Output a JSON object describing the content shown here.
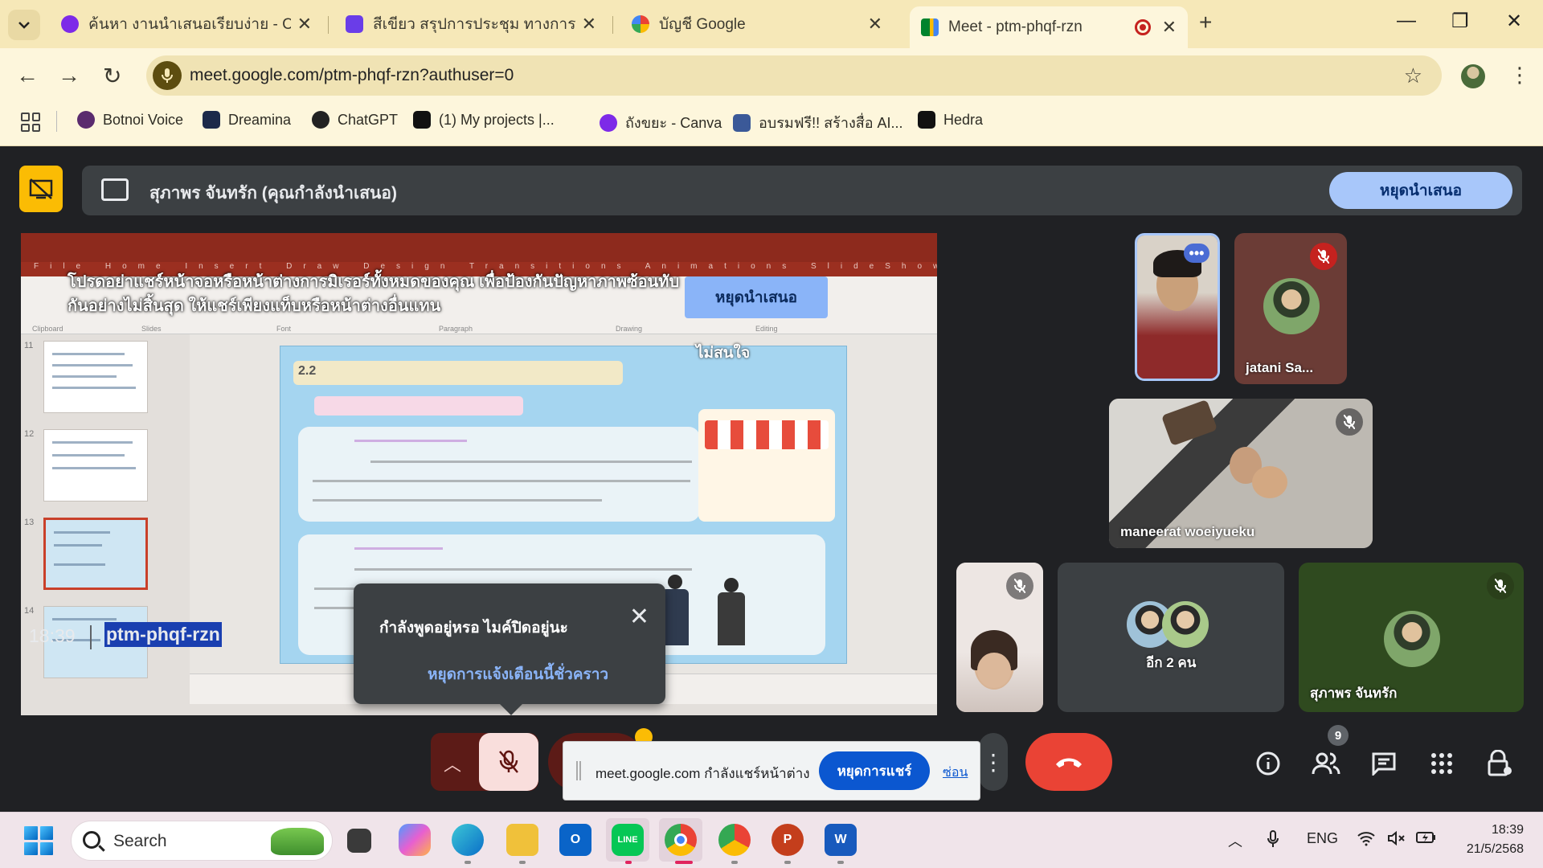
{
  "browser": {
    "tabs": [
      {
        "title": "ค้นหา งานนำเสนอเรียบง่าย - Canva",
        "icon": "canva-icon",
        "color": "#7d2ae8"
      },
      {
        "title": "สีเขียว สรุปการประชุม ทางการ พรีเซ",
        "icon": "canva-icon",
        "color": "#6a3de8"
      },
      {
        "title": "บัญชี Google",
        "icon": "google-icon",
        "color": "#4285f4"
      },
      {
        "title": "Meet - ptm-phqf-rzn",
        "icon": "meet-icon",
        "color": "#00832d",
        "active": true
      }
    ],
    "url": "meet.google.com/ptm-phqf-rzn?authuser=0",
    "bookmarks": [
      {
        "label": "Botnoi Voice",
        "color": "#5a2b6e"
      },
      {
        "label": "Dreamina",
        "color": "#1c2a4a"
      },
      {
        "label": "ChatGPT",
        "color": "#222222"
      },
      {
        "label": "(1)  My projects |...",
        "color": "#111111"
      },
      {
        "label": "ถังขยะ - Canva",
        "color": "#7d2ae8"
      },
      {
        "label": "อบรมฟรี!! สร้างสื่อ AI...",
        "color": "#3b5998"
      },
      {
        "label": "Hedra",
        "color": "#111111"
      }
    ]
  },
  "meet": {
    "presenting_banner": {
      "text": "สุภาพร จันทรัก (คุณกำลังนำเสนอ)",
      "stop_label": "หยุดนำเสนอ"
    },
    "mirror_warning": {
      "text": "โปรดอย่าแชร์หน้าจอหรือหน้าต่างการมิเรอร์ทั้งหมดของคุณ เพื่อป้องกันปัญหาภาพซ้อนทับกันอย่างไม่สิ้นสุด ให้แชร์เพียงแท็บหรือหน้าต่างอื่นแทน",
      "stop_label": "หยุดนำเสนอ",
      "ignore_label": "ไม่สนใจ"
    },
    "shared_slide": {
      "slide_number": "2.2"
    },
    "mic_popup": {
      "text": "กำลังพูดอยู่หรอ ไมค์ปิดอยู่นะ",
      "link": "หยุดการแจ้งเตือนนี้ชั่วคราว"
    },
    "participants": [
      {
        "name": "",
        "muted": false
      },
      {
        "name": "jatani Sa...",
        "muted": true
      },
      {
        "name": "maneerat woeiyueku",
        "muted": true
      },
      {
        "name": "",
        "muted": true
      },
      {
        "name": "อีก 2 คน",
        "muted": false
      },
      {
        "name": "สุภาพร จันทรัก",
        "muted": true
      }
    ],
    "time": "18:39",
    "meeting_code": "ptm-phqf-rzn",
    "people_count": "9",
    "share_bar": {
      "text": "meet.google.com กำลังแชร์หน้าต่าง",
      "stop_label": "หยุดการแชร์",
      "hide_label": "ซ่อน"
    }
  },
  "taskbar": {
    "search_placeholder": "Search",
    "lang": "ENG",
    "time": "18:39",
    "date": "21/5/2568"
  }
}
